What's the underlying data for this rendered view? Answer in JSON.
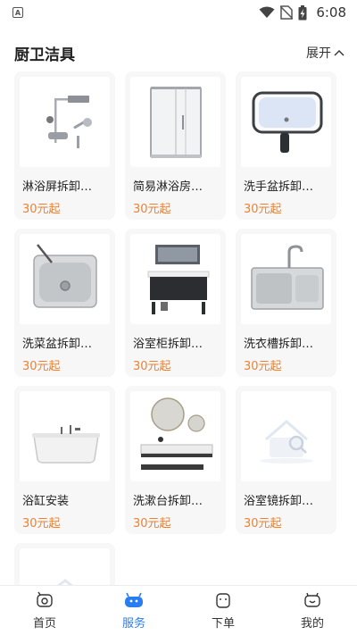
{
  "status": {
    "time": "6:08",
    "app_icon_letter": "A"
  },
  "section": {
    "title": "厨卫洁具",
    "expand_label": "展开"
  },
  "items": [
    {
      "name": "淋浴屏拆卸…",
      "price": "30元起",
      "icon": "shower-icon"
    },
    {
      "name": "简易淋浴房…",
      "price": "30元起",
      "icon": "shower-room-icon"
    },
    {
      "name": "洗手盆拆卸…",
      "price": "30元起",
      "icon": "wash-basin-icon"
    },
    {
      "name": "洗菜盆拆卸…",
      "price": "30元起",
      "icon": "kitchen-sink-icon"
    },
    {
      "name": "浴室柜拆卸…",
      "price": "30元起",
      "icon": "bathroom-cabinet-icon"
    },
    {
      "name": "洗衣槽拆卸…",
      "price": "30元起",
      "icon": "double-sink-icon"
    },
    {
      "name": "浴缸安装",
      "price": "30元起",
      "icon": "bathtub-icon"
    },
    {
      "name": "洗漱台拆卸…",
      "price": "30元起",
      "icon": "vanity-icon"
    },
    {
      "name": "浴室镜拆卸…",
      "price": "30元起",
      "icon": "placeholder-image-icon"
    }
  ],
  "tabs": [
    {
      "label": "首页",
      "icon": "home-icon",
      "active": false
    },
    {
      "label": "服务",
      "icon": "service-icon",
      "active": true
    },
    {
      "label": "下单",
      "icon": "order-icon",
      "active": false
    },
    {
      "label": "我的",
      "icon": "profile-icon",
      "active": false
    }
  ],
  "colors": {
    "accent": "#2a7df0",
    "price": "#f07f2e",
    "card_bg": "#f7f7f7"
  }
}
